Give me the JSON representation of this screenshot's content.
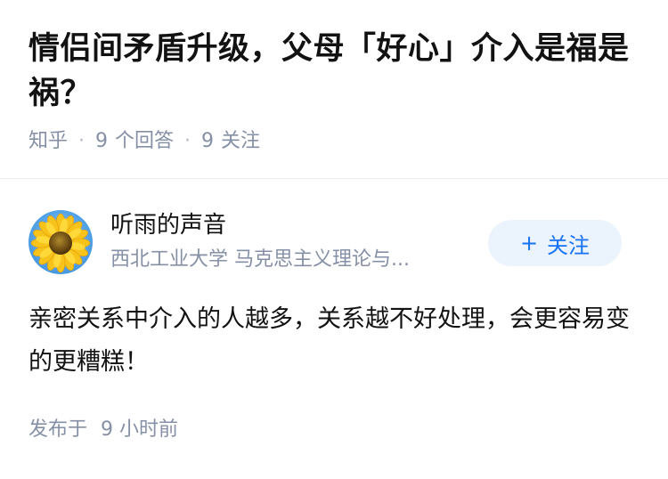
{
  "question": {
    "title": "情侣间矛盾升级，父母「好心」介入是福是祸？",
    "source": "知乎",
    "answer_count": "9",
    "answer_label": "个回答",
    "follow_count": "9",
    "follow_label": "关注"
  },
  "answer": {
    "author": {
      "name": "听雨的声音",
      "headline": "西北工业大学 马克思主义理论与...",
      "avatar_icon": "sunflower-avatar"
    },
    "follow_button": {
      "plus": "+",
      "label": "关注"
    },
    "content": "亲密关系中介入的人越多，关系越不好处理，会更容易变的更糟糕！",
    "time": {
      "prefix": "发布于",
      "value": "9 小时前"
    }
  },
  "colors": {
    "accent": "#1772f6",
    "button_bg": "#ebf3fc",
    "meta_gray": "#8590a6",
    "text": "#121212"
  }
}
